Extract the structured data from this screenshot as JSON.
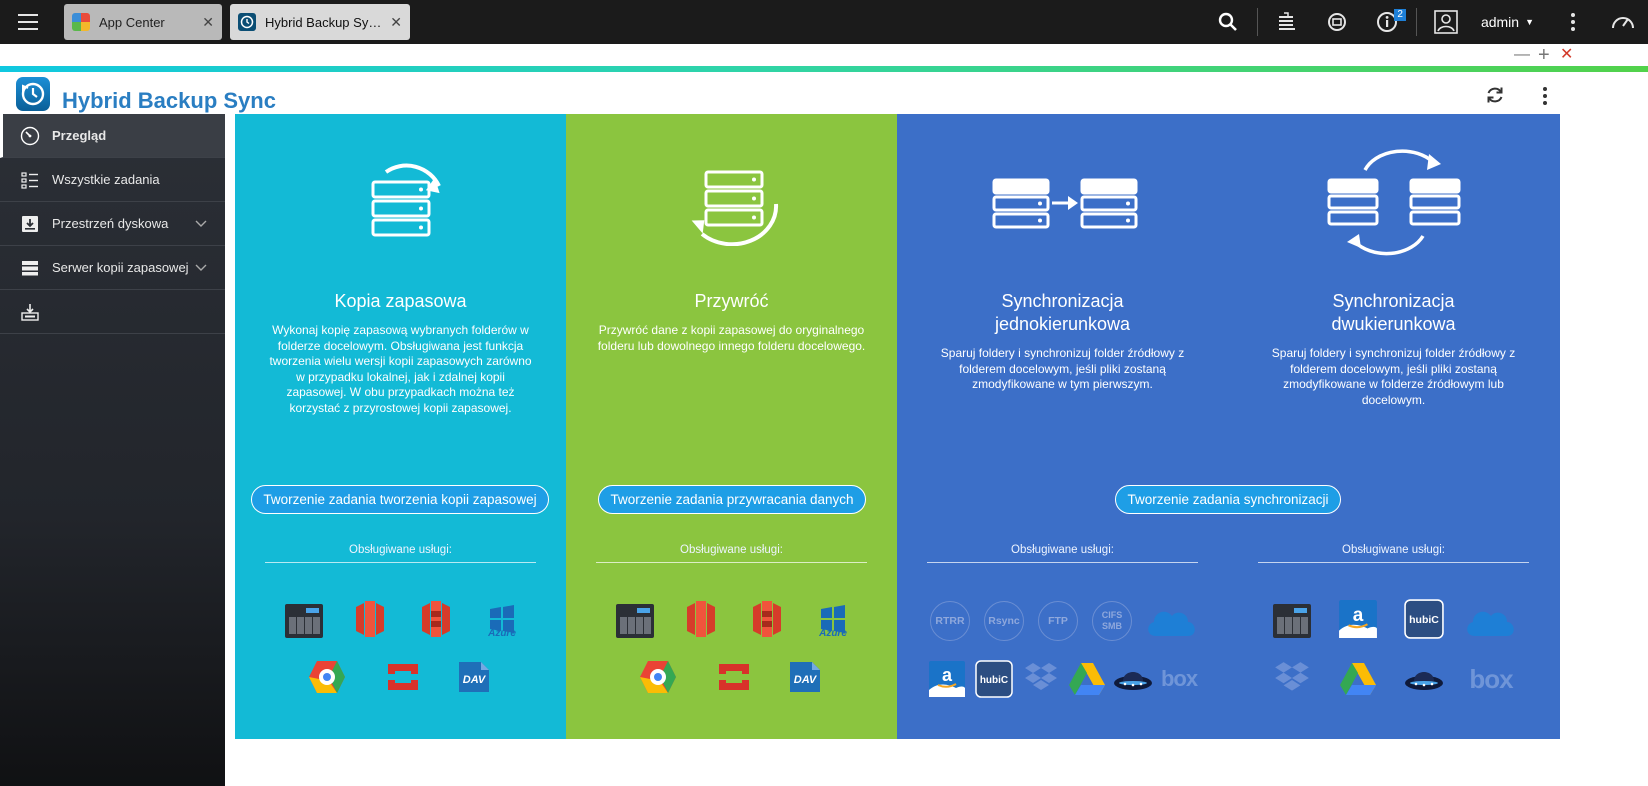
{
  "taskbar": {
    "tabs": [
      {
        "label": "App Center"
      },
      {
        "label": "Hybrid Backup Syn..."
      }
    ],
    "notifications_badge": "2",
    "user": "admin"
  },
  "app": {
    "title": "Hybrid Backup Sync"
  },
  "sidebar": {
    "items": [
      {
        "label": "Przegląd"
      },
      {
        "label": "Wszystkie zadania"
      },
      {
        "label": "Przestrzeń dyskowa"
      },
      {
        "label": "Serwer kopii zapasowej"
      },
      {
        "label": ""
      }
    ]
  },
  "panels": {
    "backup": {
      "title": "Kopia zapasowa",
      "description": "Wykonaj kopię zapasową wybranych folderów w folderze docelowym. Obsługiwana jest funkcja tworzenia wielu wersji kopii zapasowych zarówno w przypadku lokalnej, jak i zdalnej kopii zapasowej. W obu przypadkach można też korzystać z przyrostowej kopii zapasowej.",
      "button": "Tworzenie zadania tworzenia kopii zapasowej",
      "services_label": "Obsługiwane usługi:"
    },
    "restore": {
      "title": "Przywróć",
      "description": "Przywróć dane z kopii zapasowej do oryginalnego folderu lub dowolnego innego folderu docelowego.",
      "button": "Tworzenie zadania przywracania danych",
      "services_label": "Obsługiwane usługi:"
    },
    "sync": {
      "button": "Tworzenie zadania synchronizacji",
      "oneway": {
        "title_line1": "Synchronizacja",
        "title_line2": "jednokierunkowa",
        "description": "Sparuj foldery i synchronizuj folder źródłowy z folderem docelowym, jeśli pliki zostaną zmodyfikowane w tym pierwszym.",
        "services_label": "Obsługiwane usługi:",
        "svc_rtrr": "RTRR",
        "svc_rsync": "Rsync",
        "svc_ftp": "FTP",
        "svc_cifs": "CIFS SMB"
      },
      "twoway": {
        "title_line1": "Synchronizacja",
        "title_line2": "dwukierunkowa",
        "description": "Sparuj foldery i synchronizuj folder źródłowy z folderem docelowym, jeśli pliki zostaną zmodyfikowane w folderze źródłowym lub docelowym.",
        "services_label": "Obsługiwane usługi:"
      }
    }
  },
  "service_text": {
    "azure": "Azure",
    "dav": "DAV",
    "hubic": "hubiC",
    "box": "box"
  },
  "colors": {
    "backup": "#13bad6",
    "restore": "#8bc53f",
    "sync": "#3c6fc8",
    "title": "#2a7ec2"
  }
}
